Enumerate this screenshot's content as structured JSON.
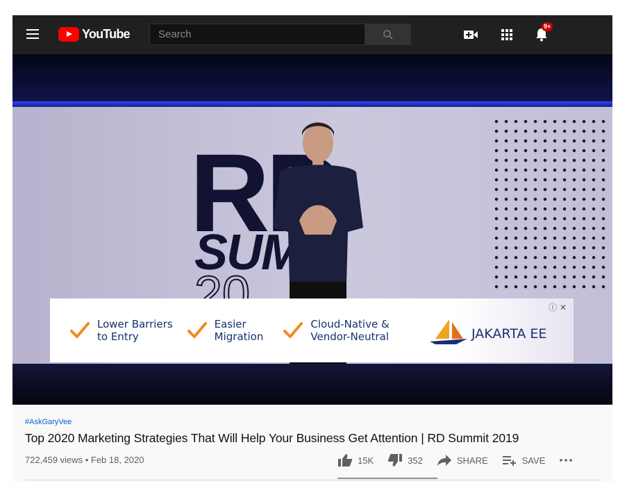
{
  "header": {
    "logo_text": "YouTube",
    "search_placeholder": "Search",
    "notification_badge": "9+"
  },
  "video": {
    "ad": {
      "items": [
        {
          "line1": "Lower Barriers",
          "line2": "to Entry"
        },
        {
          "line1": "Easier",
          "line2": "Migration"
        },
        {
          "line1": "Cloud-Native &",
          "line2": "Vendor-Neutral"
        }
      ],
      "brand": "JAKARTA EE"
    }
  },
  "meta": {
    "hashtag": "#AskGaryVee",
    "title": "Top 2020 Marketing Strategies That Will Help Your Business Get Attention | RD Summit 2019",
    "views_date": "722,459 views • Feb 18, 2020",
    "likes": "15K",
    "dislikes": "352",
    "share_label": "SHARE",
    "save_label": "SAVE",
    "like_ratio": 0.977
  },
  "colors": {
    "brand_red": "#ff0000",
    "link_blue": "#065fd4",
    "ad_check_orange": "#f08a1c",
    "ad_text_navy": "#13326b"
  }
}
